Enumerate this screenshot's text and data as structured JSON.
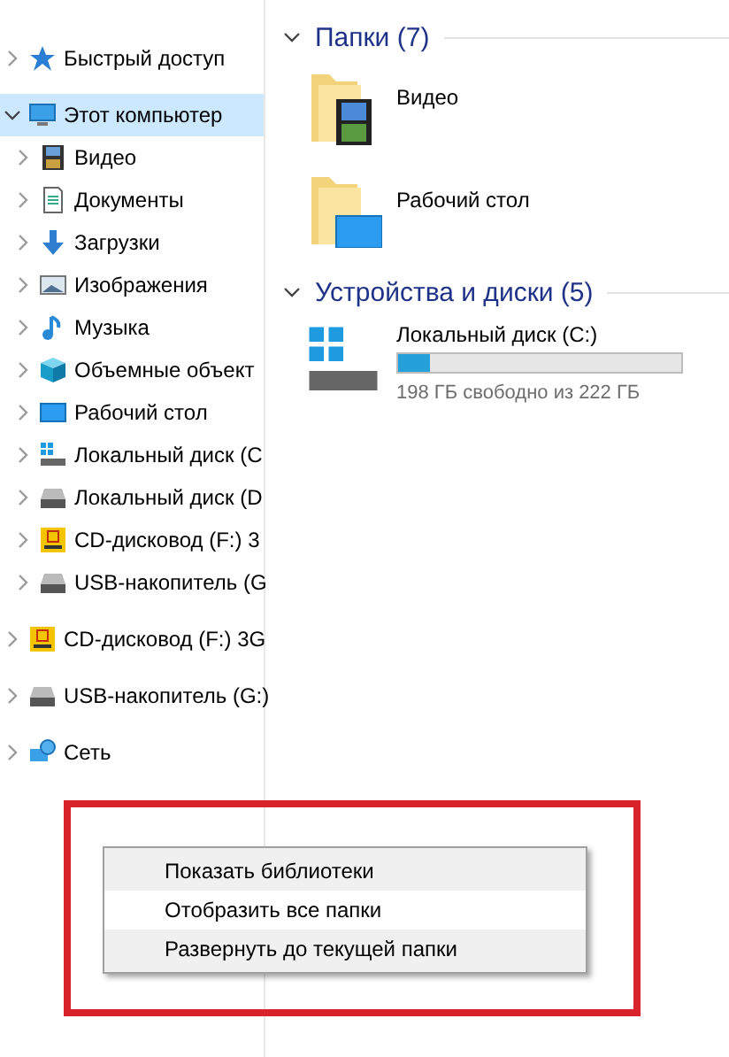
{
  "nav": [
    {
      "label": "Быстрый доступ",
      "kind": "star",
      "expanded": false,
      "selected": false
    },
    {
      "label": "Этот компьютер",
      "kind": "computer",
      "expanded": true,
      "selected": true,
      "children": [
        {
          "label": "Видео",
          "kind": "video",
          "expanded": false,
          "selected": false
        },
        {
          "label": "Документы",
          "kind": "documents",
          "expanded": false,
          "selected": false
        },
        {
          "label": "Загрузки",
          "kind": "download",
          "expanded": false,
          "selected": false
        },
        {
          "label": "Изображения",
          "kind": "pictures",
          "expanded": false,
          "selected": false
        },
        {
          "label": "Музыка",
          "kind": "music",
          "expanded": false,
          "selected": false
        },
        {
          "label": "Объемные объект",
          "kind": "objects",
          "expanded": false,
          "selected": false
        },
        {
          "label": "Рабочий стол",
          "kind": "desktop",
          "expanded": false,
          "selected": false
        },
        {
          "label": "Локальный диск (C",
          "kind": "windrive",
          "expanded": false,
          "selected": false
        },
        {
          "label": "Локальный диск (D",
          "kind": "drive",
          "expanded": false,
          "selected": false
        },
        {
          "label": "CD-дисковод (F:) 3",
          "kind": "cd",
          "expanded": false,
          "selected": false
        },
        {
          "label": "USB-накопитель (G",
          "kind": "drive",
          "expanded": false,
          "selected": false
        }
      ]
    },
    {
      "label": "CD-дисковод (F:) 3G",
      "kind": "cd",
      "expanded": false,
      "selected": false
    },
    {
      "label": "USB-накопитель (G:)",
      "kind": "drive",
      "expanded": false,
      "selected": false
    },
    {
      "label": "Сеть",
      "kind": "network",
      "expanded": false,
      "selected": false
    }
  ],
  "sections": [
    {
      "title": "Папки (7)",
      "expanded": true,
      "items": [
        {
          "name": "Видео",
          "kind": "video"
        },
        {
          "name": "Рабочий стол",
          "kind": "desktop"
        }
      ]
    },
    {
      "title": "Устройства и диски (5)",
      "expanded": true,
      "items": [
        {
          "name": "Локальный диск (C:)",
          "kind": "windrive",
          "level": 0.11,
          "free": "198 ГБ свободно из 222 ГБ"
        }
      ]
    }
  ],
  "context_menu": [
    {
      "label": "Показать библиотеки",
      "selected": false
    },
    {
      "label": "Отобразить все папки",
      "selected": true
    },
    {
      "label": "Развернуть до текущей папки",
      "selected": false
    }
  ]
}
